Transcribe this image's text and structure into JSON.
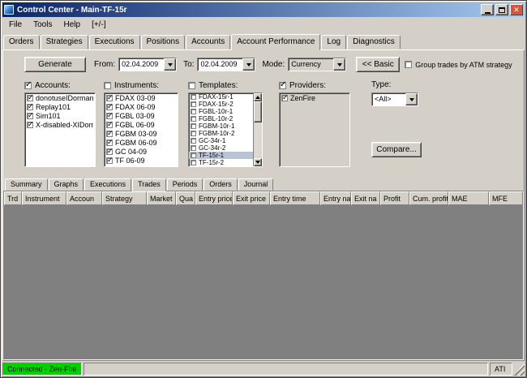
{
  "window": {
    "title": "Control Center - Main-TF-15r",
    "status_left": "Connected - Zen-Fire",
    "status_right": "ATI"
  },
  "colors": {
    "titlebar-start": "#0a246a",
    "titlebar-end": "#a6caf0",
    "close-red": "#d2563c",
    "status-green": "#00cf00",
    "selection": "#b9c4d6",
    "table-gray": "#808080"
  },
  "menu": {
    "items": [
      "File",
      "Tools",
      "Help",
      "[+/-]"
    ]
  },
  "main_tabs": {
    "items": [
      {
        "label": "Orders",
        "selected": false
      },
      {
        "label": "Strategies",
        "selected": false
      },
      {
        "label": "Executions",
        "selected": false
      },
      {
        "label": "Positions",
        "selected": false
      },
      {
        "label": "Accounts",
        "selected": false
      },
      {
        "label": "Account Performance",
        "selected": true
      },
      {
        "label": "Log",
        "selected": false
      },
      {
        "label": "Diagnostics",
        "selected": false
      }
    ]
  },
  "toolbar": {
    "generate_label": "Generate",
    "from_label": "From:",
    "from_value": "02.04.2009",
    "to_label": "To:",
    "to_value": "02.04.2009",
    "mode_label": "Mode:",
    "mode_value": "Currency",
    "basic_label": "<< Basic",
    "group_checkbox_label": "Group trades by ATM strategy",
    "group_checked": false
  },
  "filters": {
    "accounts": {
      "label": "Accounts:",
      "checked": true,
      "items": [
        {
          "label": "donotuseIDorman",
          "checked": true,
          "selected": false
        },
        {
          "label": "Replay101",
          "checked": true,
          "selected": false
        },
        {
          "label": "Sim101",
          "checked": true,
          "selected": false
        },
        {
          "label": "X-disabled-XIDorm",
          "checked": true,
          "selected": false
        }
      ]
    },
    "instruments": {
      "label": "Instruments:",
      "checked": false,
      "items": [
        {
          "label": "FDAX 03-09",
          "checked": true,
          "selected": false
        },
        {
          "label": "FDAX 06-09",
          "checked": true,
          "selected": false
        },
        {
          "label": "FGBL 03-09",
          "checked": true,
          "selected": false
        },
        {
          "label": "FGBL 06-09",
          "checked": true,
          "selected": false
        },
        {
          "label": "FGBM 03-09",
          "checked": true,
          "selected": false
        },
        {
          "label": "FGBM 06-09",
          "checked": true,
          "selected": false
        },
        {
          "label": "GC 04-09",
          "checked": true,
          "selected": false
        },
        {
          "label": "TF 06-09",
          "checked": true,
          "selected": false
        }
      ]
    },
    "templates": {
      "label": "Templates:",
      "checked": false,
      "items": [
        {
          "label": "FDAX-15r-1",
          "checked": false,
          "selected": false
        },
        {
          "label": "FDAX-15r-2",
          "checked": false,
          "selected": false
        },
        {
          "label": "FGBL-10r-1",
          "checked": false,
          "selected": false
        },
        {
          "label": "FGBL-10r-2",
          "checked": false,
          "selected": false
        },
        {
          "label": "FGBM-10r-1",
          "checked": false,
          "selected": false
        },
        {
          "label": "FGBM-10r-2",
          "checked": false,
          "selected": false
        },
        {
          "label": "GC-34r-1",
          "checked": false,
          "selected": false
        },
        {
          "label": "GC-34r-2",
          "checked": false,
          "selected": false
        },
        {
          "label": "TF-15r-1",
          "checked": false,
          "selected": true
        },
        {
          "label": "TF-15r-2",
          "checked": false,
          "selected": false
        }
      ]
    },
    "providers": {
      "label": "Providers:",
      "checked": true,
      "items": [
        {
          "label": "ZenFire",
          "checked": true,
          "selected": false
        }
      ]
    },
    "type_label": "Type:",
    "type_value": "<All>",
    "compare_label": "Compare..."
  },
  "sub_tabs": {
    "items": [
      {
        "label": "Summary",
        "selected": false
      },
      {
        "label": "Graphs",
        "selected": false
      },
      {
        "label": "Executions",
        "selected": false
      },
      {
        "label": "Trades",
        "selected": true
      },
      {
        "label": "Periods",
        "selected": false
      },
      {
        "label": "Orders",
        "selected": false
      },
      {
        "label": "Journal",
        "selected": false
      }
    ]
  },
  "trades_table": {
    "columns": [
      "Trd",
      "Instrument",
      "Accoun",
      "Strategy",
      "Market",
      "Qua",
      "Entry price",
      "Exit price",
      "Entry time",
      "Entry na",
      "Exit na",
      "Profit",
      "Cum. profit",
      "MAE",
      "MFE"
    ],
    "rows": []
  }
}
